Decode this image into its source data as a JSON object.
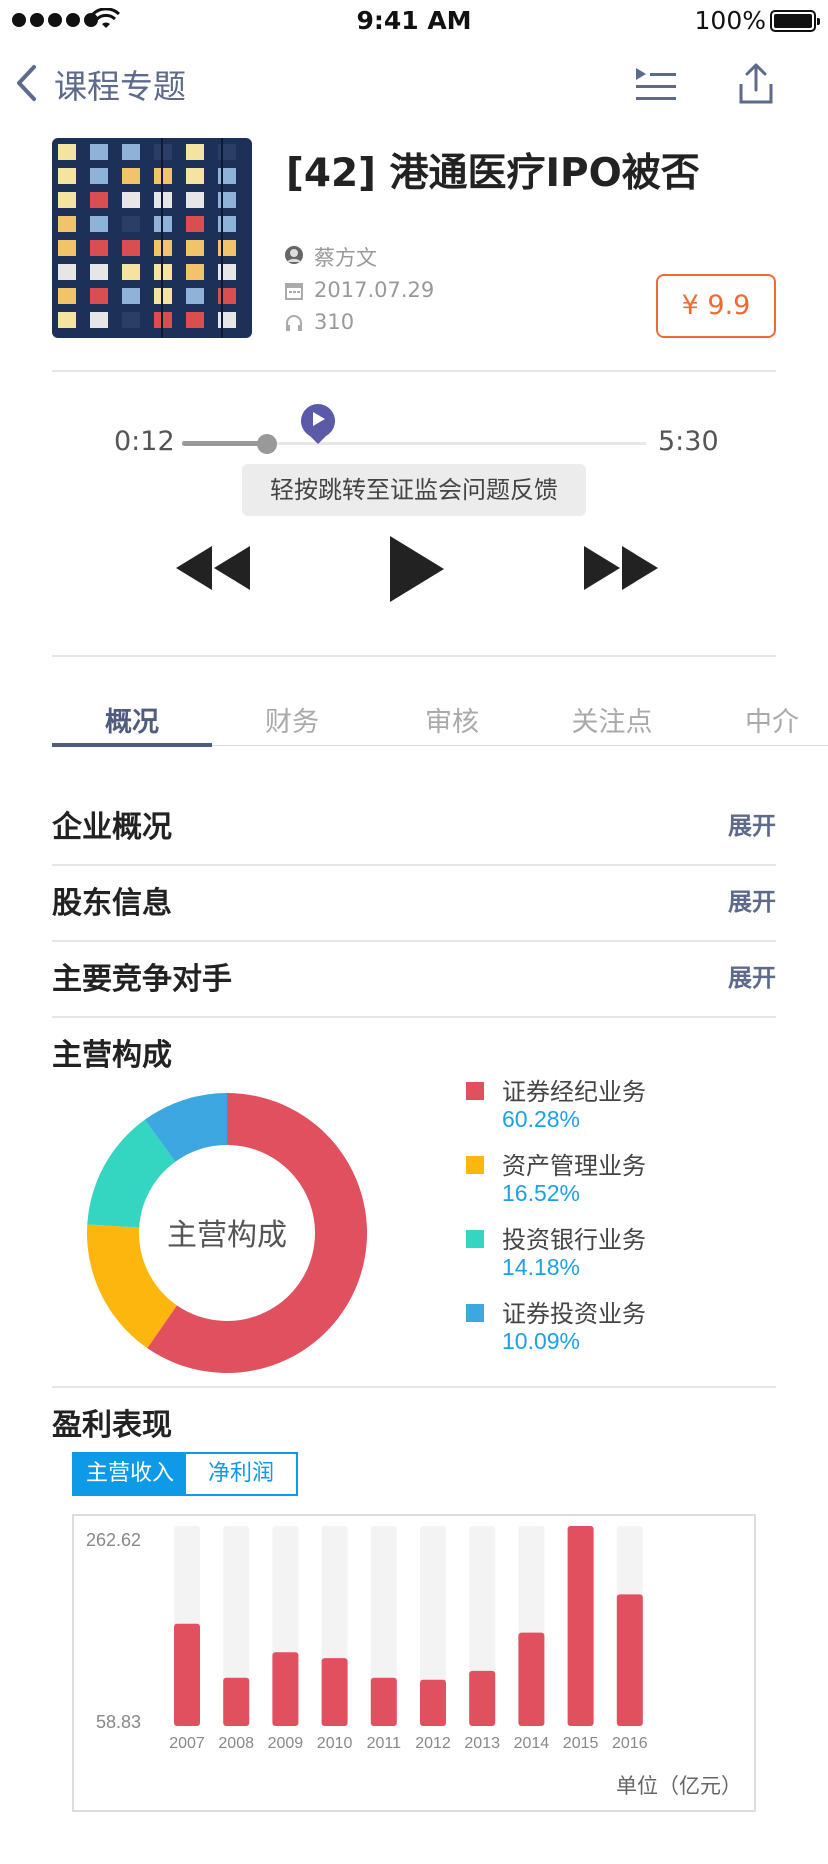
{
  "status_bar": {
    "time": "9:41 AM",
    "battery": "100%"
  },
  "nav": {
    "title": "课程专题"
  },
  "course": {
    "title": "[42] 港通医疗IPO被否",
    "author": "蔡方文",
    "date": "2017.07.29",
    "listens": "310",
    "price": "¥ 9.9"
  },
  "player": {
    "current_time": "0:12",
    "total_time": "5:30",
    "progress": 0.036,
    "tooltip": "轻按跳转至证监会问题反馈"
  },
  "tabs": [
    {
      "label": "概况"
    },
    {
      "label": "财务"
    },
    {
      "label": "审核"
    },
    {
      "label": "关注点"
    },
    {
      "label": "中介"
    }
  ],
  "sections": [
    {
      "title": "企业概况",
      "action": "展开"
    },
    {
      "title": "股东信息",
      "action": "展开"
    },
    {
      "title": "主要竞争对手",
      "action": "展开"
    }
  ],
  "composition": {
    "title": "主营构成",
    "center_label": "主营构成",
    "items": [
      {
        "name": "证券经纪业务",
        "value": "60.28%",
        "color": "#e0505e"
      },
      {
        "name": "资产管理业务",
        "value": "16.52%",
        "color": "#fcb60d"
      },
      {
        "name": "投资银行业务",
        "value": "14.18%",
        "color": "#35d6c1"
      },
      {
        "name": "证券投资业务",
        "value": "10.09%",
        "color": "#3ca7e0"
      }
    ]
  },
  "profit": {
    "title": "盈利表现",
    "toggle": {
      "active": "主营收入",
      "inactive": "净利润"
    },
    "y_max_label": "262.62",
    "y_min_label": "58.83",
    "unit": "单位（亿元）"
  },
  "chart_data": [
    {
      "type": "pie",
      "title": "主营构成",
      "categories": [
        "证券经纪业务",
        "资产管理业务",
        "投资银行业务",
        "证券投资业务"
      ],
      "values": [
        60.28,
        16.52,
        14.18,
        10.09
      ]
    },
    {
      "type": "bar",
      "categories": [
        "2007",
        "2008",
        "2009",
        "2010",
        "2011",
        "2012",
        "2013",
        "2014",
        "2015",
        "2016"
      ],
      "values": [
        163,
        108,
        134,
        128,
        108,
        106,
        115,
        154,
        262.62,
        193
      ],
      "ylim": [
        58.83,
        262.62
      ],
      "ylabel": "单位（亿元）",
      "colors": {
        "bar": "#e0505e",
        "track": "#f3f3f3"
      }
    }
  ]
}
